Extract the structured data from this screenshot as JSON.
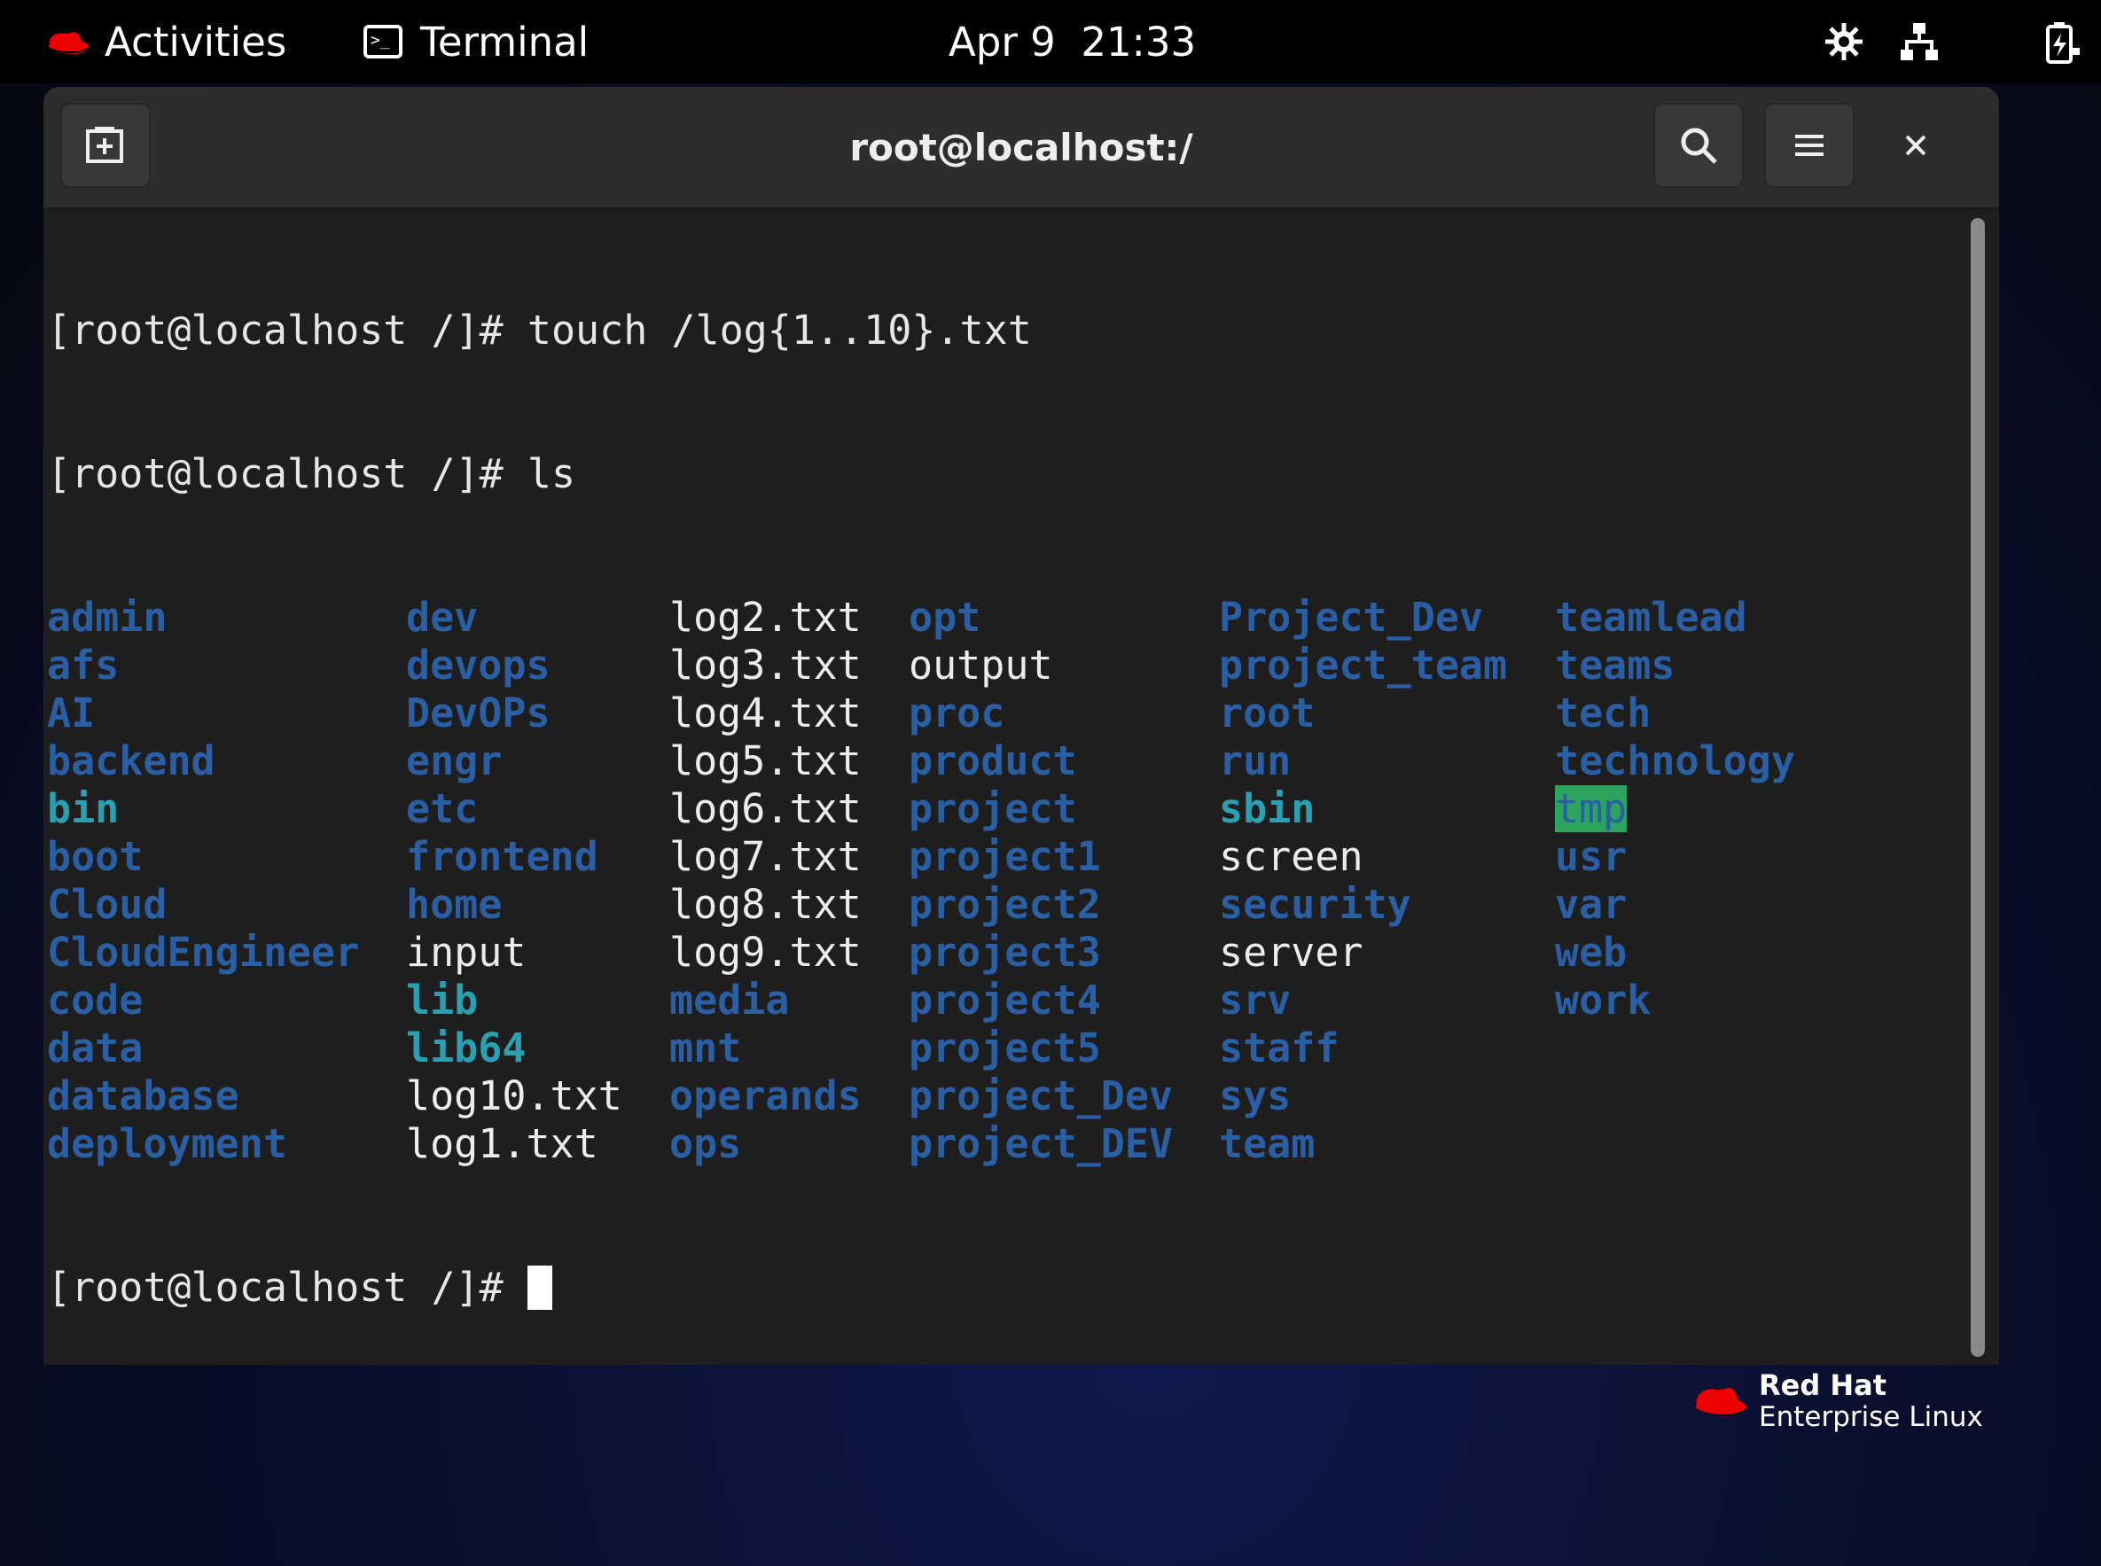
{
  "topbar": {
    "activities_label": "Activities",
    "app_label": "Terminal",
    "date": "Apr 9",
    "time": "21:33"
  },
  "window": {
    "title": "root@localhost:/"
  },
  "terminal": {
    "line1": "[root@localhost /]# touch /log{1..10}.txt",
    "line2": "[root@localhost /]# ls",
    "prompt": "[root@localhost /]# ",
    "ls_entries": [
      {
        "name": "admin",
        "type": "dir"
      },
      {
        "name": "afs",
        "type": "dir"
      },
      {
        "name": "AI",
        "type": "dir"
      },
      {
        "name": "backend",
        "type": "dir"
      },
      {
        "name": "bin",
        "type": "link"
      },
      {
        "name": "boot",
        "type": "dir"
      },
      {
        "name": "Cloud",
        "type": "dir"
      },
      {
        "name": "CloudEngineer",
        "type": "dir"
      },
      {
        "name": "code",
        "type": "dir"
      },
      {
        "name": "data",
        "type": "dir"
      },
      {
        "name": "database",
        "type": "dir"
      },
      {
        "name": "deployment",
        "type": "dir"
      },
      {
        "name": "dev",
        "type": "dir"
      },
      {
        "name": "devops",
        "type": "dir"
      },
      {
        "name": "DevOPs",
        "type": "dir"
      },
      {
        "name": "engr",
        "type": "dir"
      },
      {
        "name": "etc",
        "type": "dir"
      },
      {
        "name": "frontend",
        "type": "dir"
      },
      {
        "name": "home",
        "type": "dir"
      },
      {
        "name": "input",
        "type": "file"
      },
      {
        "name": "lib",
        "type": "link"
      },
      {
        "name": "lib64",
        "type": "link"
      },
      {
        "name": "log10.txt",
        "type": "file"
      },
      {
        "name": "log1.txt",
        "type": "file"
      },
      {
        "name": "log2.txt",
        "type": "file"
      },
      {
        "name": "log3.txt",
        "type": "file"
      },
      {
        "name": "log4.txt",
        "type": "file"
      },
      {
        "name": "log5.txt",
        "type": "file"
      },
      {
        "name": "log6.txt",
        "type": "file"
      },
      {
        "name": "log7.txt",
        "type": "file"
      },
      {
        "name": "log8.txt",
        "type": "file"
      },
      {
        "name": "log9.txt",
        "type": "file"
      },
      {
        "name": "media",
        "type": "dir"
      },
      {
        "name": "mnt",
        "type": "dir"
      },
      {
        "name": "operands",
        "type": "dir"
      },
      {
        "name": "ops",
        "type": "dir"
      },
      {
        "name": "opt",
        "type": "dir"
      },
      {
        "name": "output",
        "type": "file"
      },
      {
        "name": "proc",
        "type": "dir"
      },
      {
        "name": "product",
        "type": "dir"
      },
      {
        "name": "project",
        "type": "dir"
      },
      {
        "name": "project1",
        "type": "dir"
      },
      {
        "name": "project2",
        "type": "dir"
      },
      {
        "name": "project3",
        "type": "dir"
      },
      {
        "name": "project4",
        "type": "dir"
      },
      {
        "name": "project5",
        "type": "dir"
      },
      {
        "name": "project_Dev",
        "type": "dir"
      },
      {
        "name": "project_DEV",
        "type": "dir"
      },
      {
        "name": "Project_Dev",
        "type": "dir"
      },
      {
        "name": "project_team",
        "type": "dir"
      },
      {
        "name": "root",
        "type": "dir"
      },
      {
        "name": "run",
        "type": "dir"
      },
      {
        "name": "sbin",
        "type": "link"
      },
      {
        "name": "screen",
        "type": "file"
      },
      {
        "name": "security",
        "type": "dir"
      },
      {
        "name": "server",
        "type": "file"
      },
      {
        "name": "srv",
        "type": "dir"
      },
      {
        "name": "staff",
        "type": "dir"
      },
      {
        "name": "sys",
        "type": "dir"
      },
      {
        "name": "team",
        "type": "dir"
      },
      {
        "name": "teamlead",
        "type": "dir"
      },
      {
        "name": "teams",
        "type": "dir"
      },
      {
        "name": "tech",
        "type": "dir"
      },
      {
        "name": "technology",
        "type": "dir"
      },
      {
        "name": "tmp",
        "type": "sticky"
      },
      {
        "name": "usr",
        "type": "dir"
      },
      {
        "name": "var",
        "type": "dir"
      },
      {
        "name": "web",
        "type": "dir"
      },
      {
        "name": "work",
        "type": "dir"
      }
    ]
  },
  "colors": {
    "dir": "#2a5fa6",
    "link": "#2aa1b3",
    "file": "#ececec",
    "sticky_bg": "#2aa45f",
    "brand_red": "#ee0000"
  },
  "branding": {
    "line1": "Red Hat",
    "line2": "Enterprise Linux"
  },
  "icons": [
    "redhat-logo-icon",
    "terminal-icon",
    "accessibility-icon",
    "network-icon",
    "battery-icon",
    "new-tab-icon",
    "search-icon",
    "hamburger-menu-icon",
    "close-icon"
  ]
}
